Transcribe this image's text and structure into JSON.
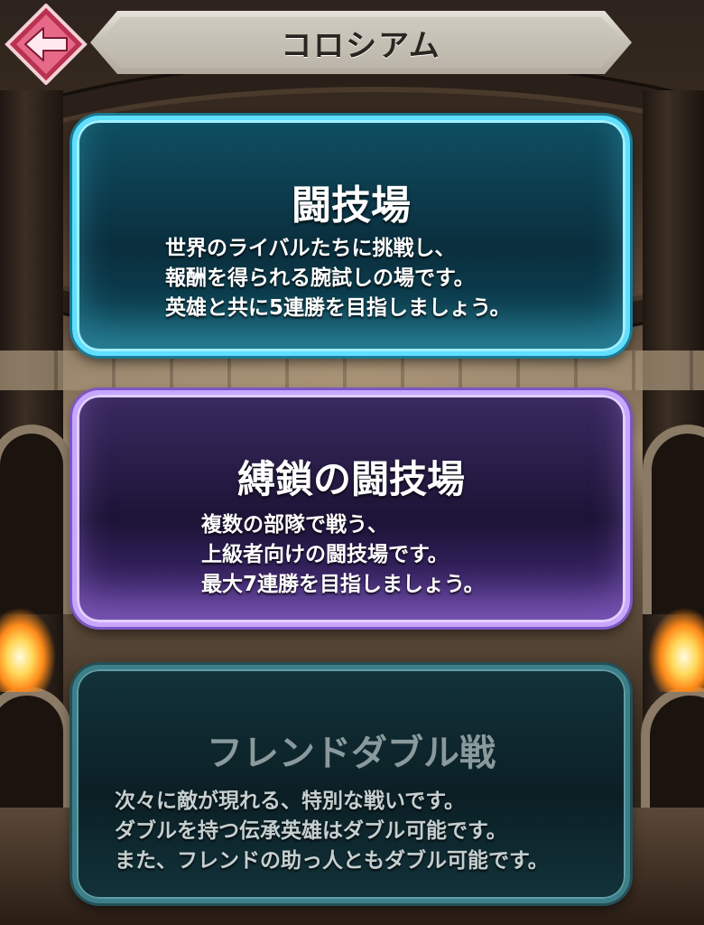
{
  "header": {
    "title": "コロシアム",
    "back_icon": "left-arrow-icon"
  },
  "menu": [
    {
      "id": "arena",
      "title": "闘技場",
      "description": [
        "世界のライバルたちに挑戦し、",
        "報酬を得られる腕試しの場です。",
        "英雄と共に5連勝を目指しましょう。"
      ],
      "accent": "#5fe0ff",
      "enabled": true
    },
    {
      "id": "bound-arena",
      "title": "縛鎖の闘技場",
      "description": [
        "複数の部隊で戦う、",
        "上級者向けの闘技場です。",
        "最大7連勝を目指しましょう。"
      ],
      "accent": "#c9a6ff",
      "enabled": true
    },
    {
      "id": "friend-double",
      "title": "フレンドダブル戦",
      "description": [
        "次々に敵が現れる、特別な戦いです。",
        "ダブルを持つ伝承英雄はダブル可能です。",
        "また、フレンドの助っ人ともダブル可能です。"
      ],
      "accent": "#3d7f89",
      "enabled": false
    }
  ]
}
